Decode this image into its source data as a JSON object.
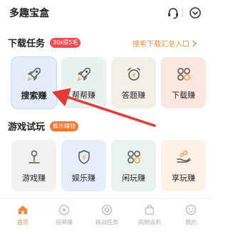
{
  "header": {
    "title": "多趣宝盒",
    "support_icon": "headset-icon",
    "menu_icon": "chevron-down-circle-icon"
  },
  "download_section": {
    "title": "下载任务",
    "badge": "30s得5毛",
    "entry_label": "搜索下载汇总入口",
    "cards": [
      {
        "label": "搜索赚",
        "icon": "rocket-icon",
        "color": "#e3edf8"
      },
      {
        "label": "帮帮赚",
        "icon": "rocket-icon",
        "color": "#e7f1ee"
      },
      {
        "label": "答题赚",
        "icon": "alarm-clock-icon",
        "color": "#f2efe7"
      },
      {
        "label": "下载赚",
        "icon": "grid-flower-icon",
        "color": "#fbe6e0"
      }
    ]
  },
  "game_section": {
    "title": "游戏试玩",
    "badge": "娱乐赚钱",
    "cards": [
      {
        "label": "游戏赚",
        "icon": "joystick-icon",
        "color": "#f1f1f1"
      },
      {
        "label": "娱乐赚",
        "icon": "yen-shield-icon",
        "color": "#e5edf9"
      },
      {
        "label": "闲玩赚",
        "icon": "grid-flower-icon",
        "color": "#e9f2ec"
      },
      {
        "label": "享玩赚",
        "icon": "coin-hand-icon",
        "color": "#fdf0e4"
      }
    ]
  },
  "tabbar": {
    "active_color": "#f0873a",
    "items": [
      {
        "label": "首页",
        "icon": "home-icon",
        "active": true
      },
      {
        "label": "视频赚",
        "icon": "play-icon",
        "active": false
      },
      {
        "label": "挑战任务",
        "icon": "target-icon",
        "active": false
      },
      {
        "label": "购物返利",
        "icon": "gift-bag-icon",
        "active": false
      },
      {
        "label": "我的",
        "icon": "smile-face-icon",
        "active": false
      }
    ]
  },
  "annotation": {
    "arrow_color": "#e53935"
  }
}
